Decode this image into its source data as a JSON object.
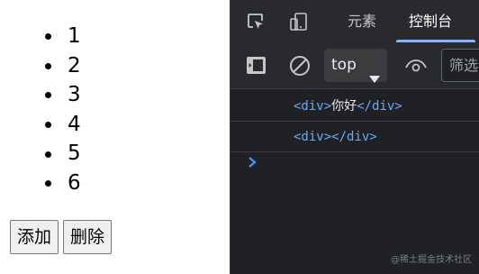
{
  "page": {
    "list_items": [
      "1",
      "2",
      "3",
      "4",
      "5",
      "6"
    ],
    "add_button": "添加",
    "delete_button": "删除"
  },
  "devtools": {
    "tabs": {
      "elements": "元素",
      "console": "控制台"
    },
    "context": "top",
    "filter_placeholder": "筛选",
    "console_lines": [
      {
        "open_tag": "<div>",
        "text": "你好",
        "close_tag": "</div>"
      },
      {
        "open_tag": "<div>",
        "text": "",
        "close_tag": "</div>"
      }
    ],
    "icons": [
      "inspect-icon",
      "device-toggle-icon",
      "sidebar-toggle-icon",
      "clear-console-icon",
      "eye-icon",
      "chevron-down-icon",
      "prompt-chevron-icon"
    ],
    "colors": {
      "background": "#202124",
      "tag": "#6aa9f4",
      "active_tab_underline": "#8ab4f8"
    }
  },
  "watermark": "@稀土掘金技术社区"
}
